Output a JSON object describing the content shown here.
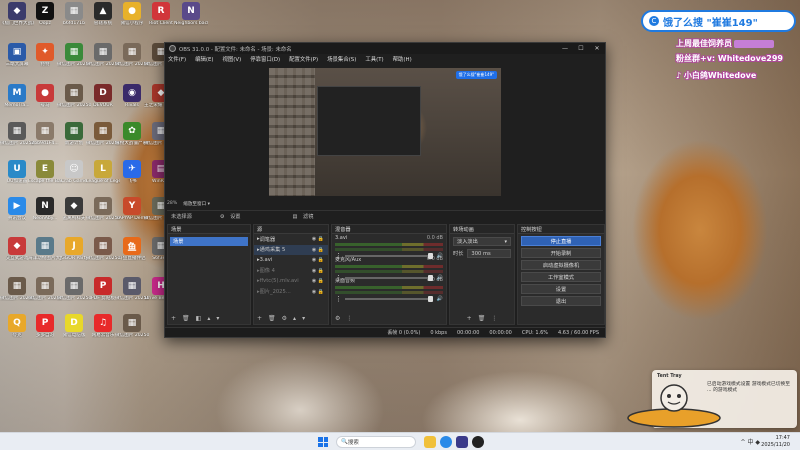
{
  "desktop": {
    "icons": [
      {
        "label": "《极门世界大战》",
        "color": "#3b3b6b",
        "glyph": "◆"
      },
      {
        "label": "Oopz",
        "color": "#111",
        "glyph": "Z"
      },
      {
        "label": "b6fd171b",
        "color": "#8a8a8a",
        "glyph": "▦"
      },
      {
        "label": "管辖系统",
        "color": "#2a2a2a",
        "glyph": "▲"
      },
      {
        "label": "微信小程序",
        "color": "#e8b12a",
        "glyph": "●"
      },
      {
        "label": "Riot Client",
        "color": "#d1363a",
        "glyph": "R"
      },
      {
        "label": "Neighbors back Fro...",
        "color": "#5a4a8a",
        "glyph": "N"
      },
      {
        "label": "三端大屏幕",
        "color": "#2a5aa8",
        "glyph": "▣"
      },
      {
        "label": "特特",
        "color": "#e05a2a",
        "glyph": "✦"
      },
      {
        "label": "微信图片 2025-08...",
        "color": "#3a8a3a",
        "glyph": "▦"
      },
      {
        "label": "微信图片 2025091...",
        "color": "#6a6a6a",
        "glyph": "▦"
      },
      {
        "label": "微信图片 2025091...",
        "color": "#7a6a5a",
        "glyph": "▦"
      },
      {
        "label": "微信图片 2025091...",
        "color": "#5a4a3a",
        "glyph": "▦"
      },
      {
        "label": "LOCKDOWN Protocol",
        "color": "#333",
        "glyph": "L"
      },
      {
        "label": "MemoTra...",
        "color": "#2a7ac8",
        "glyph": "M"
      },
      {
        "label": "号马",
        "color": "#c83a3a",
        "glyph": "●"
      },
      {
        "label": "微信图片 2025091...",
        "color": "#6a5a4a",
        "glyph": "▦"
      },
      {
        "label": "DEVOUR",
        "color": "#7a2a2a",
        "glyph": "D"
      },
      {
        "label": "Rivals",
        "color": "#3a2a6a",
        "glyph": "◉"
      },
      {
        "label": "王之荣耀 (The King...",
        "color": "#a8362a",
        "glyph": "◆"
      },
      {
        "label": "Blossom Voyage",
        "color": "#c86aa8",
        "glyph": "✿"
      },
      {
        "label": "微信图片 2025091...",
        "color": "#5a5a5a",
        "glyph": "▦"
      },
      {
        "label": "2bb9d1F4...",
        "color": "#8a7a6a",
        "glyph": "▦"
      },
      {
        "label": "新游计划",
        "color": "#3a6a3a",
        "glyph": "▦"
      },
      {
        "label": "微信图片 2025073...",
        "color": "#7a5a3a",
        "glyph": "▦"
      },
      {
        "label": "植物大战僵尸杂交...",
        "color": "#3a8a2a",
        "glyph": "✿"
      },
      {
        "label": "微信图片 2025101...",
        "color": "#6a6a7a",
        "glyph": "▦"
      },
      {
        "label": "死神/超人 EEK",
        "color": "#2a2a5a",
        "glyph": "◆"
      },
      {
        "label": "UU加速器",
        "color": "#2a8ac8",
        "glyph": "U"
      },
      {
        "label": "Escape the Backrooms",
        "color": "#8a8a3a",
        "glyph": "E"
      },
      {
        "label": "Crab Game",
        "color": "#c8c8c8",
        "glyph": "☺"
      },
      {
        "label": "League of Legends",
        "color": "#c8a83a",
        "glyph": "L"
      },
      {
        "label": "飞书",
        "color": "#2a6ae8",
        "glyph": "✈"
      },
      {
        "label": "WinRAR",
        "color": "#8a2a6a",
        "glyph": "▤"
      },
      {
        "label": "酷狗音乐",
        "color": "#1a6ae8",
        "glyph": "K"
      },
      {
        "label": "腾讯会议",
        "color": "#2a8ae8",
        "glyph": "▶"
      },
      {
        "label": "NeonAby...",
        "color": "#2a2a2a",
        "glyph": "N"
      },
      {
        "label": "逃离鸭科夫",
        "color": "#3a3a3a",
        "glyph": "◆"
      },
      {
        "label": "微信图片 2025091...",
        "color": "#7a6a5a",
        "glyph": "▦"
      },
      {
        "label": "YAPYAP Demo",
        "color": "#c84a2a",
        "glyph": "Y"
      },
      {
        "label": "微信图片 2025071...",
        "color": "#6a6a5a",
        "glyph": "▦"
      },
      {
        "label": "嘴嘴素材大全",
        "color": "#3a3a3a",
        "glyph": "▦"
      },
      {
        "label": "交互式游戏",
        "color": "#c83a3a",
        "glyph": "◆"
      },
      {
        "label": "海洋动物图片大全",
        "color": "#5a7a8a",
        "glyph": "▦"
      },
      {
        "label": "JGGOR Party",
        "color": "#e8a82a",
        "glyph": "J"
      },
      {
        "label": "微信图片 2025073...",
        "color": "#7a5a4a",
        "glyph": "▦"
      },
      {
        "label": "斗鱼直播伴侣",
        "color": "#e86a1a",
        "glyph": "鱼"
      },
      {
        "label": "S6f3e...",
        "color": "#6a6a6a",
        "glyph": "▦"
      },
      {
        "label": "微信图片 2025072...",
        "color": "#5a5a5a",
        "glyph": "▦"
      },
      {
        "label": "微信图片 2025080...",
        "color": "#6a5a4a",
        "glyph": "▦"
      },
      {
        "label": "微信图片 2025072...",
        "color": "#7a6a5a",
        "glyph": "▦"
      },
      {
        "label": "微信图片 2025072...",
        "color": "#6a6a6a",
        "glyph": "▦"
      },
      {
        "label": "PDF 剪贴板",
        "color": "#c82a2a",
        "glyph": "P"
      },
      {
        "label": "微信图片 2025071...",
        "color": "#5a5a6a",
        "glyph": "▦"
      },
      {
        "label": "Drive Beyon...",
        "color": "#c82a8a",
        "glyph": "H"
      },
      {
        "label": "回收站",
        "color": "#cfd6df",
        "glyph": "🗑"
      },
      {
        "label": "夸克",
        "color": "#e8a82a",
        "glyph": "Q"
      },
      {
        "label": "多多自习",
        "color": "#e82a2a",
        "glyph": "P"
      },
      {
        "label": "微信电脑版",
        "color": "#e8d82a",
        "glyph": "D"
      },
      {
        "label": "网易云音乐",
        "color": "#e82a2a",
        "glyph": "♫"
      },
      {
        "label": "微信图片 2025073...",
        "color": "#6a5a4a",
        "glyph": "▦"
      }
    ]
  },
  "obs": {
    "title": "OBS 31.0.0 - 配置文件: 未命名 - 场景: 未命名",
    "menu": [
      "文件(F)",
      "编辑(E)",
      "视图(V)",
      "停靠窗口(D)",
      "配置文件(P)",
      "场景集合(S)",
      "工具(T)",
      "帮助(H)"
    ],
    "preview_badge": "饿了么搜\"崔崔149\"",
    "zoom_label": "28%",
    "scale_label": "缩放至窗口",
    "no_source": "未选择源",
    "props_label": "设置",
    "filters_label": "滤镜",
    "scenes_header": "场景",
    "scene_name": "场景",
    "sources_header": "源",
    "sources": [
      {
        "name": "调笔器",
        "state": "normal"
      },
      {
        "name": "通鸡采集 5",
        "state": "selected"
      },
      {
        "name": "3.avi",
        "state": "normal"
      },
      {
        "name": "图像 4",
        "state": "dim"
      },
      {
        "name": "ffvtc(5).mlv.avi",
        "state": "dim"
      },
      {
        "name": "图片_2025...",
        "state": "dim"
      }
    ],
    "mixer_header": "混音器",
    "mixer": [
      {
        "name": "3.avi",
        "db": "0.0 dB"
      },
      {
        "name": "麦克风/Aux",
        "db": "0.0 dB"
      },
      {
        "name": "桌面音频",
        "db": "0.0 dB"
      }
    ],
    "transitions_header": "转场动画",
    "transition": "淡入淡出",
    "duration_label": "时长",
    "duration_value": "300 ms",
    "controls_header": "控制按钮",
    "controls": [
      "停止直播",
      "开始录制",
      "启动虚拟摄像机",
      "工作室模式",
      "设置",
      "退出"
    ],
    "status": {
      "dropped": "丢帧 0 (0.0%)",
      "bitrate": "0 kbps",
      "stream_time": "00:00:00",
      "rec_time": "00:00:00",
      "cpu": "CPU: 1.6%",
      "fps": "4.63 / 60.00 FPS"
    }
  },
  "overlay": {
    "search_text": "饿了么搜 \"崔崔149\"",
    "line1": "上周最佳饲养员",
    "line2": "粉丝群+v: Whitedove299",
    "line3": "小白鸽Whitedove"
  },
  "notification": {
    "app": "Tent Tray",
    "body": "已启动游戏模式设置 游戏模式已切换至 ... 的游戏模式"
  },
  "taskbar": {
    "search_placeholder": "搜索",
    "time": "17:47",
    "date": "2025/11/20",
    "tray": "^  中  ◆"
  },
  "colors": {
    "accent": "#2f62b5",
    "overlay_blue": "#1f7ae0",
    "overlay_pink": "#b0479e"
  }
}
